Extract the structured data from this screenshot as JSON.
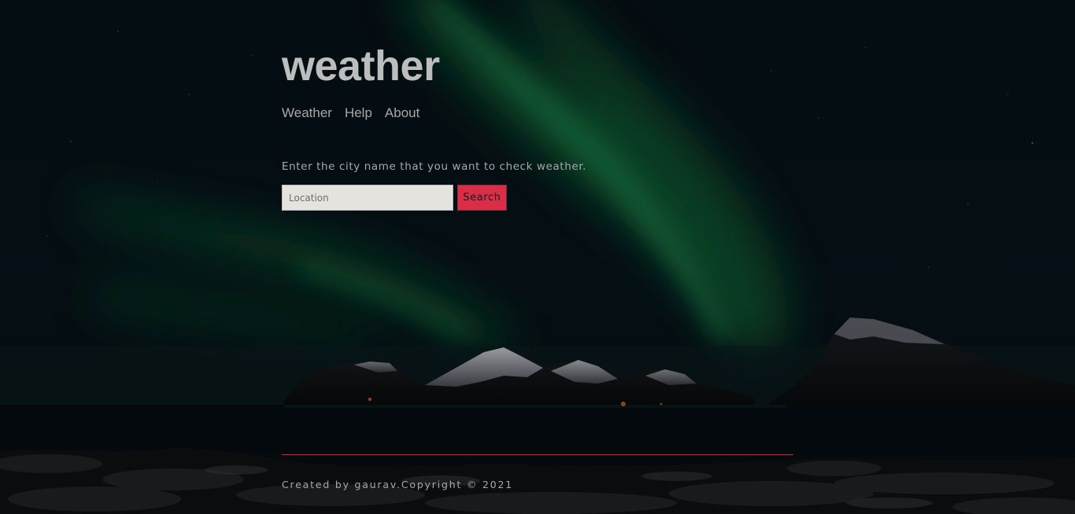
{
  "header": {
    "title": "weather"
  },
  "nav": {
    "items": [
      {
        "label": "Weather"
      },
      {
        "label": "Help"
      },
      {
        "label": "About"
      }
    ]
  },
  "main": {
    "prompt": "Enter the city name that you want to check weather.",
    "search": {
      "placeholder": "Location",
      "value": "",
      "button_label": "Search"
    }
  },
  "footer": {
    "text": "Created by gaurav.Copyright © 2021"
  },
  "colors": {
    "accent": "#d92d48",
    "text": "#a8a8a8",
    "title": "#bdbdbd",
    "background": "#03080d"
  }
}
